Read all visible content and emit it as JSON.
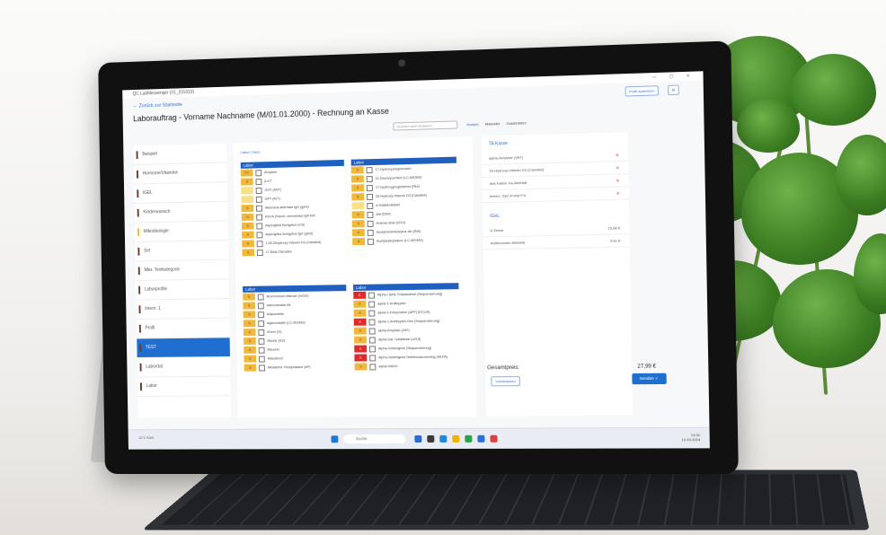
{
  "app": {
    "window_title": "QC LabMessenger (#1_231010)",
    "back_link": "Zurück zur Startseite",
    "page_title": "Laborauftrag - Vorname Nachname (M/01.01.2000) - Rechnung an Kasse",
    "top_button_1": "Profil speichern",
    "search_placeholder": "Suchen nach Analyten",
    "tabs": [
      "Analyte",
      "Materials",
      "Zusatzdaten"
    ]
  },
  "sidebar": {
    "items": [
      {
        "label": "Beispiel"
      },
      {
        "label": "Hormone/Vitamine"
      },
      {
        "label": "IGEL"
      },
      {
        "label": "Kinderwunsch"
      },
      {
        "label": "Mikrobiologie"
      },
      {
        "label": "Set"
      },
      {
        "label": "Mikr. Textkategorie"
      },
      {
        "label": "Laborprofile"
      },
      {
        "label": "Intern. 1"
      },
      {
        "label": "Profil"
      },
      {
        "label": "TEST"
      },
      {
        "label": "Labordat"
      },
      {
        "label": "Labor"
      }
    ]
  },
  "main": {
    "breadcrumb": "Labor | Kaes",
    "panel1": {
      "header": "Labor",
      "rows": [
        {
          "tag": "CT-Kasse",
          "label": "Amylase"
        },
        {
          "tag": "S",
          "label": "β-KT"
        },
        {
          "tag": "",
          "label": "GOT (AST)"
        },
        {
          "tag": "",
          "label": "GPT (ALT)"
        },
        {
          "tag": "S",
          "label": "Alternaria alternata IgG (gm6)"
        },
        {
          "tag": "S",
          "label": "ASCA (Sacch. cerevisiae) IgA EIA"
        },
        {
          "tag": "S",
          "label": "Aspergillus fumigatus (m3)"
        },
        {
          "tag": "S",
          "label": "Aspergillus fumigatus IgG (gm3)"
        },
        {
          "tag": "S",
          "label": "1,25-Dihydroxy-Vitamin D3 (Calcitriol)"
        },
        {
          "tag": "S",
          "label": "17-Beta-Östradiol"
        }
      ]
    },
    "panel2": {
      "header": "Labor",
      "rows": [
        {
          "tag": "S",
          "label": "17-Hydroxypregnenolon"
        },
        {
          "tag": "S",
          "label": "11-Desoxycortisol (LC-MS/MS)"
        },
        {
          "tag": "S",
          "label": "17-Hydroxyprogesteron (RIA)"
        },
        {
          "tag": "S",
          "label": "25-Hydroxy-Vitamin D3 (Calcidiol)"
        },
        {
          "tag": "",
          "label": "a-Galaktosidase"
        },
        {
          "tag": "S",
          "label": "Aal (f264)"
        },
        {
          "tag": "S",
          "label": "Ananas sbsv (f210)"
        },
        {
          "tag": "S",
          "label": "Acetylcholinrezeptor-Ak (RIA)"
        },
        {
          "tag": "S",
          "label": "Acetylsalicylsäure (LC-MS/MS)"
        }
      ]
    },
    "panel3": {
      "header": "Labor",
      "rows": [
        {
          "tag": "S",
          "label": "Acremonium kiliense (m202)"
        },
        {
          "tag": "S",
          "label": "Adenosinase-Ak"
        },
        {
          "tag": "S",
          "label": "Adiponektin"
        },
        {
          "tag": "S",
          "label": "Aganovalalin (LC-MS/MS)"
        },
        {
          "tag": "S",
          "label": "Ahorn (t1)"
        },
        {
          "tag": "S",
          "label": "Akazie (t19)"
        },
        {
          "tag": "S",
          "label": "Albumin"
        },
        {
          "tag": "S",
          "label": "Aldosteron"
        },
        {
          "tag": "S",
          "label": "Alkalische Phosphatase (AP)"
        }
      ]
    },
    "panel4": {
      "header": "Labor",
      "rows": [
        {
          "tag": "E",
          "label": "Alpha-/ Beta-Thalassämie (Sequenzierung)"
        },
        {
          "tag": "S",
          "label": "alpha-1-Antitrypsin"
        },
        {
          "tag": "S",
          "label": "alpha-1-Fetoprotein (AFP) (ECLIA)"
        },
        {
          "tag": "E",
          "label": "alpha-1-Antitrypsin-Gen (Sequenzierung)"
        },
        {
          "tag": "S",
          "label": "alpha-Amylase (VAT)"
        },
        {
          "tag": "S",
          "label": "alpha-Gal, Galaktose (o215)"
        },
        {
          "tag": "E",
          "label": "Alpha-Globingene (Sequenzierung)"
        },
        {
          "tag": "E",
          "label": "Alpha-Globingene Deletionsscreening (MLPA)"
        },
        {
          "tag": "S",
          "label": "alpha-HBDH"
        }
      ]
    }
  },
  "right_panel": {
    "kasse_header": "TA Kasse",
    "kasse_items": [
      "alpha-Amylase (VAT)",
      "25-Hydroxy-Vitamin D3 (Calcidiol)",
      "Anti-Faktor-Xa-Aktivität",
      "Ammo. Zyto Portal F.K."
    ],
    "igel_header": "IGeL",
    "igel_items": [
      {
        "label": "D-Dimer",
        "price": "19,68 €"
      },
      {
        "label": "Antithrombin-Aktivität",
        "price": "9,61 €"
      }
    ],
    "total_label": "Gesamtpreis:",
    "total_value": "27,99 €",
    "preview_button": "Vorbesetzen",
    "send_button": "Senden"
  },
  "taskbar": {
    "weather": "11°C Kühl",
    "search": "Suche",
    "time": "13:31",
    "date": "12.03.2024"
  }
}
